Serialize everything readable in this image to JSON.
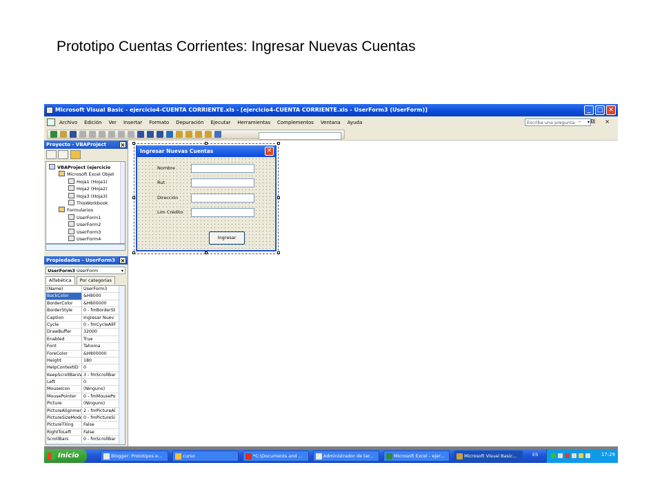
{
  "slide_title": "Prototipo Cuentas Corrientes: Ingresar Nuevas Cuentas",
  "window": {
    "title": "Microsoft Visual Basic - ejercicio4-CUENTA CORRIENTE.xls - [ejercicio4-CUENTA CORRIENTE.xls - UserForm3 (UserForm)]",
    "minimize": "_",
    "maximize": "□",
    "close": "✕"
  },
  "menu": {
    "items": [
      "Archivo",
      "Edición",
      "Ver",
      "Insertar",
      "Formato",
      "Depuración",
      "Ejecutar",
      "Herramientas",
      "Complementos",
      "Ventana",
      "Ayuda"
    ],
    "ask_placeholder": "Escriba una pregunta",
    "mdi_controls": "- ₪ ×"
  },
  "project_panel": {
    "title": "Proyecto - VBAProject",
    "tree": [
      {
        "label": "VBAProject (ejercicio",
        "level": 0
      },
      {
        "label": "Microsoft Excel Objet",
        "level": 1
      },
      {
        "label": "Hoja1 (Hoja1)",
        "level": 2
      },
      {
        "label": "Hoja2 (Hoja2)",
        "level": 2
      },
      {
        "label": "Hoja3 (Hoja3)",
        "level": 2
      },
      {
        "label": "ThisWorkbook",
        "level": 2
      },
      {
        "label": "Formularios",
        "level": 1
      },
      {
        "label": "UserForm1",
        "level": 2
      },
      {
        "label": "UserForm2",
        "level": 2
      },
      {
        "label": "UserForm3",
        "level": 2
      },
      {
        "label": "UserForm4",
        "level": 2
      }
    ]
  },
  "properties_panel": {
    "title": "Propiedades - UserForm3",
    "object_name": "UserForm3",
    "object_type": "UserForm",
    "tabs": [
      "Alfabética",
      "Por categorías"
    ],
    "rows": [
      {
        "name": "(Name)",
        "value": "UserForm3"
      },
      {
        "name": "BackColor",
        "value": "&H8000",
        "selected": true
      },
      {
        "name": "BorderColor",
        "value": "&H800000"
      },
      {
        "name": "BorderStyle",
        "value": "0 - fmBorderSt"
      },
      {
        "name": "Caption",
        "value": "Ingresar Nuev"
      },
      {
        "name": "Cycle",
        "value": "0 - fmCycleAllF"
      },
      {
        "name": "DrawBuffer",
        "value": "32000"
      },
      {
        "name": "Enabled",
        "value": "True"
      },
      {
        "name": "Font",
        "value": "Tahoma"
      },
      {
        "name": "ForeColor",
        "value": "&H800000"
      },
      {
        "name": "Height",
        "value": "180"
      },
      {
        "name": "HelpContextID",
        "value": "0"
      },
      {
        "name": "KeepScrollBarsV",
        "value": "3 - fmScrollBar"
      },
      {
        "name": "Left",
        "value": "0"
      },
      {
        "name": "MouseIcon",
        "value": "(Ninguno)"
      },
      {
        "name": "MousePointer",
        "value": "0 - fmMousePo"
      },
      {
        "name": "Picture",
        "value": "(Ninguno)"
      },
      {
        "name": "PictureAlignmen",
        "value": "2 - fmPictureAl"
      },
      {
        "name": "PictureSizeMode",
        "value": "0 - fmPictureSi"
      },
      {
        "name": "PictureTiling",
        "value": "False"
      },
      {
        "name": "RightToLeft",
        "value": "False"
      },
      {
        "name": "ScrollBars",
        "value": "0 - fmScrollBar"
      }
    ]
  },
  "userform": {
    "title": "Ingresar Nuevas Cuentas",
    "close": "✕",
    "fields": [
      {
        "label": "Nombre"
      },
      {
        "label": "Rut"
      },
      {
        "label": "Dirección"
      },
      {
        "label": "Lim Crédito"
      }
    ],
    "button": "Ingresar"
  },
  "taskbar": {
    "start": "Inicio",
    "tasks": [
      "Blogger: Prototipos e...",
      "curso",
      "*C:\\Documents and ...",
      "Administrador de tar...",
      "Microsoft Excel - ejer...",
      "Microsoft Visual Basic..."
    ],
    "active_task": 5,
    "language": "ES",
    "clock": "17:29"
  }
}
